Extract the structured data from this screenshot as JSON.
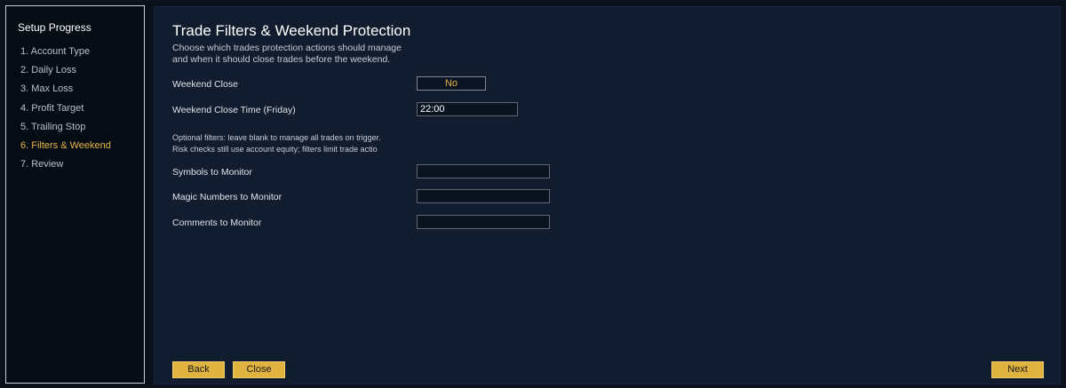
{
  "sidebar": {
    "title": "Setup Progress",
    "items": [
      {
        "label": "1. Account Type"
      },
      {
        "label": "2. Daily Loss"
      },
      {
        "label": "3. Max Loss"
      },
      {
        "label": "4. Profit Target"
      },
      {
        "label": "5. Trailing Stop"
      },
      {
        "label": "6. Filters & Weekend",
        "active": true
      },
      {
        "label": "7. Review"
      }
    ]
  },
  "main": {
    "title": "Trade Filters & Weekend Protection",
    "subtitle_line1": "Choose which trades protection actions should manage",
    "subtitle_line2": "and when it should close trades before the weekend.",
    "weekend_close": {
      "label": "Weekend Close",
      "value": "No"
    },
    "weekend_close_time": {
      "label": "Weekend Close Time (Friday)",
      "value": "22:00"
    },
    "note_line1": "Optional filters: leave blank to manage all trades on trigger.",
    "note_line2": "Risk checks still use account equity; filters limit trade actio",
    "symbols": {
      "label": "Symbols to Monitor",
      "value": ""
    },
    "magic_numbers": {
      "label": "Magic Numbers to Monitor",
      "value": ""
    },
    "comments": {
      "label": "Comments to Monitor",
      "value": ""
    }
  },
  "buttons": {
    "back": "Back",
    "close": "Close",
    "next": "Next"
  },
  "colors": {
    "accent": "#e0b340",
    "active_step": "#e6b34a",
    "panel_bg": "#111c2e",
    "sidebar_bg": "#060c14"
  }
}
